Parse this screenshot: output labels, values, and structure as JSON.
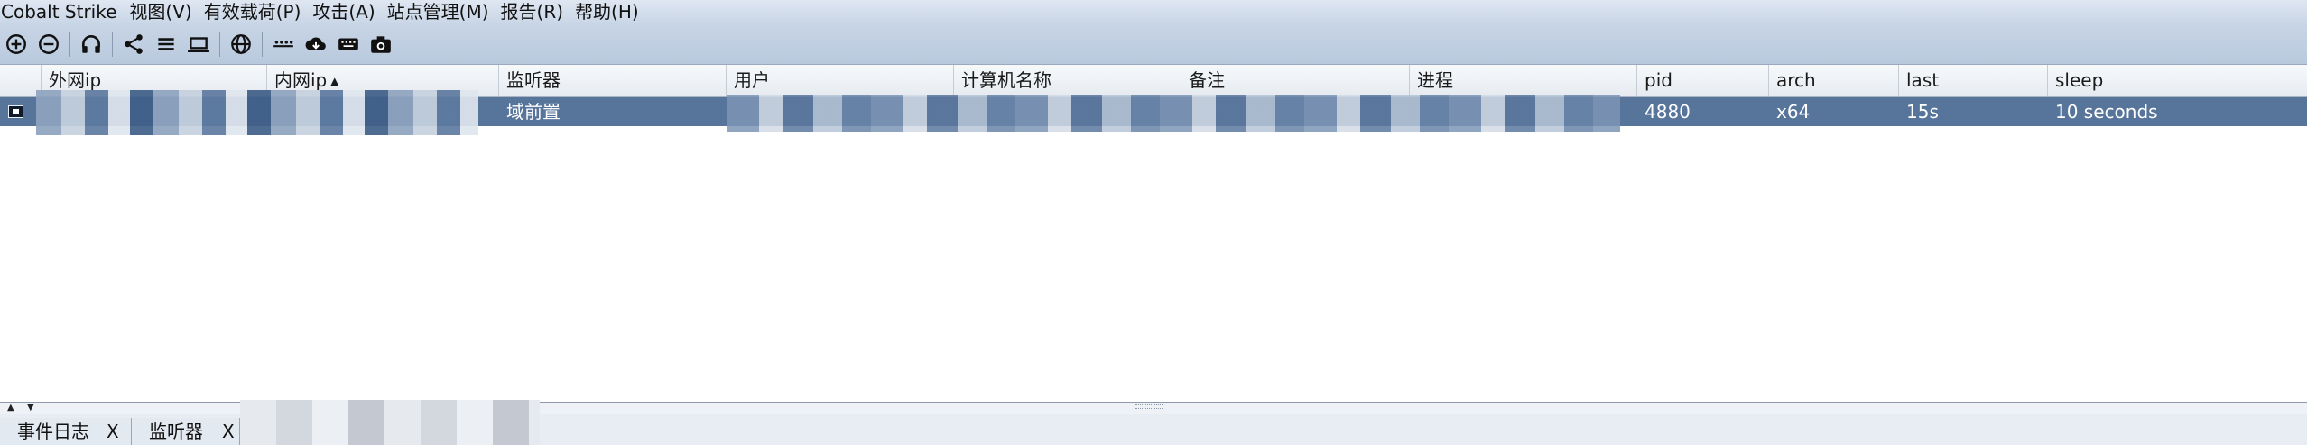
{
  "menubar": {
    "items": [
      {
        "label": "Cobalt Strike"
      },
      {
        "label": "视图(V)"
      },
      {
        "label": "有效载荷(P)"
      },
      {
        "label": "攻击(A)"
      },
      {
        "label": "站点管理(M)"
      },
      {
        "label": "报告(R)"
      },
      {
        "label": "帮助(H)"
      }
    ]
  },
  "toolbar": {
    "icons": [
      "add-connection-icon",
      "disconnect-icon",
      "headphones-icon",
      "pivot-graph-icon",
      "session-list-icon",
      "target-list-icon",
      "web-globe-icon",
      "credentials-icon",
      "downloads-icon",
      "keystrokes-icon",
      "screenshots-icon"
    ]
  },
  "table": {
    "columns": [
      "外网ip",
      "内网ip",
      "监听器",
      "用户",
      "计算机名称",
      "备注",
      "进程",
      "pid",
      "arch",
      "last",
      "sleep"
    ],
    "sorted_column": "内网ip",
    "rows": [
      {
        "external_ip": "",
        "internal_ip": "",
        "listener": "域前置",
        "user": "",
        "computer": "",
        "note": "",
        "process": "",
        "pid": "4880",
        "arch": "x64",
        "last": "15s",
        "sleep": "10 seconds"
      }
    ]
  },
  "tabs": [
    {
      "label": "事件日志",
      "close": "X"
    },
    {
      "label": "监听器",
      "close": "X"
    }
  ],
  "colors": {
    "selected_row": "#57749a",
    "menubar": "#d3deec",
    "toolbar": "#c0cfe1"
  }
}
